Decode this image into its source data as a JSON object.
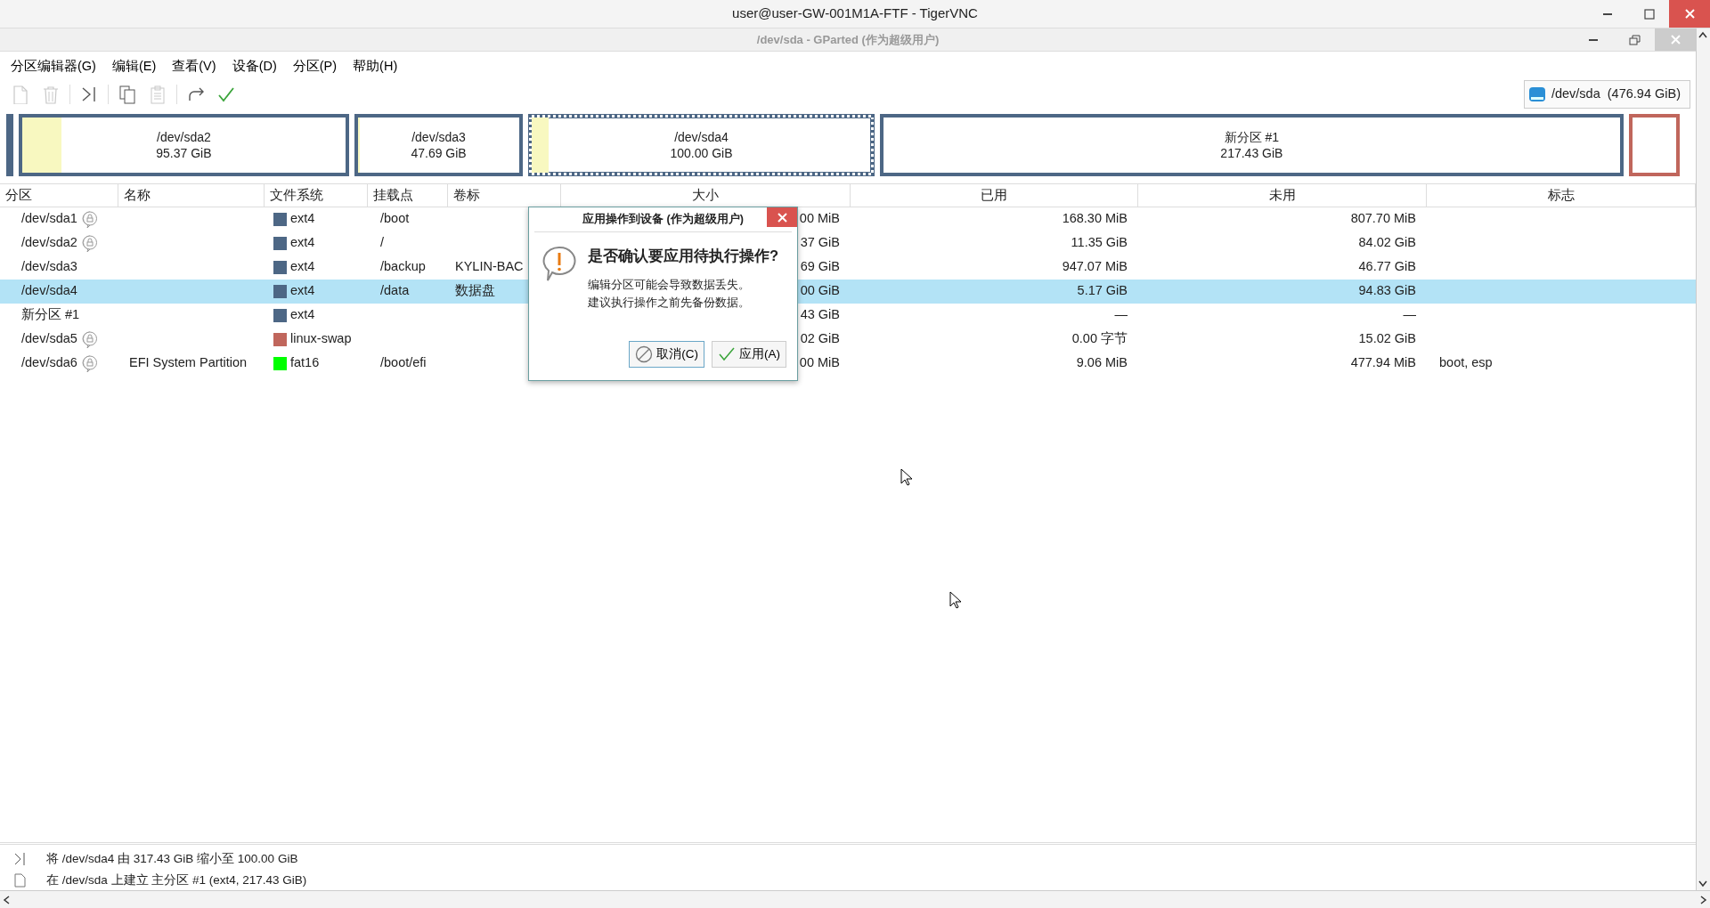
{
  "window": {
    "title": "user@user-GW-001M1A-FTF - TigerVNC"
  },
  "app_window": {
    "title": "/dev/sda - GParted (作为超级用户)"
  },
  "menu": [
    "分区编辑器(G)",
    "编辑(E)",
    "查看(V)",
    "设备(D)",
    "分区(P)",
    "帮助(H)"
  ],
  "toolbar": [
    {
      "kind": "new",
      "disabled": true
    },
    {
      "kind": "delete",
      "disabled": true
    },
    {
      "kind": "resize",
      "disabled": false
    },
    {
      "kind": "copy",
      "disabled": false
    },
    {
      "kind": "paste",
      "disabled": true
    },
    {
      "kind": "undo",
      "disabled": false
    },
    {
      "kind": "apply",
      "disabled": false
    }
  ],
  "device": {
    "path": "/dev/sda",
    "size": "(476.94 GiB)"
  },
  "partition_map": [
    {
      "kind": "sliver",
      "color": "#4d6785"
    },
    {
      "kind": "partition",
      "name": "/dev/sda2",
      "size": "95.37 GiB",
      "color": "#4d6785",
      "level": 0.12,
      "selected": false
    },
    {
      "kind": "partition",
      "name": "/dev/sda3",
      "size": "47.69 GiB",
      "color": "#4d6785",
      "level": 0.01,
      "selected": false
    },
    {
      "kind": "partition",
      "name": "/dev/sda4",
      "size": "100.00 GiB",
      "color": "#4d6785",
      "level": 0.05,
      "selected": true
    },
    {
      "kind": "partition",
      "name": "新分区 #1",
      "size": "217.43 GiB",
      "color": "#4d6785",
      "selected": false
    },
    {
      "kind": "tail",
      "color": "#c0665c",
      "selected": false
    }
  ],
  "table": {
    "columns": [
      "分区",
      "名称",
      "文件系统",
      "挂载点",
      "卷标",
      "大小",
      "已用",
      "未用",
      "标志"
    ],
    "rows": [
      {
        "partition": "/dev/sda1",
        "locked": true,
        "fs": "ext4",
        "color": "#4d6785",
        "mount": "/boot",
        "size": "00 MiB",
        "used": "168.30 MiB",
        "unused": "807.70 MiB",
        "selected": false
      },
      {
        "partition": "/dev/sda2",
        "locked": true,
        "fs": "ext4",
        "color": "#4d6785",
        "mount": "/",
        "size": "37 GiB",
        "used": "11.35 GiB",
        "unused": "84.02 GiB",
        "selected": false
      },
      {
        "partition": "/dev/sda3",
        "locked": false,
        "fs": "ext4",
        "color": "#4d6785",
        "mount": "/backup",
        "label": "KYLIN-BAC",
        "size": "69 GiB",
        "used": "947.07 MiB",
        "unused": "46.77 GiB",
        "selected": false
      },
      {
        "partition": "/dev/sda4",
        "locked": false,
        "fs": "ext4",
        "color": "#4d6785",
        "mount": "/data",
        "label": "数据盘",
        "size": "00 GiB",
        "used": "5.17 GiB",
        "unused": "94.83 GiB",
        "selected": true
      },
      {
        "partition": "新分区 #1",
        "locked": false,
        "fs": "ext4",
        "color": "#4d6785",
        "size": "43 GiB",
        "used": "—",
        "unused": "—",
        "selected": false
      },
      {
        "partition": "/dev/sda5",
        "locked": true,
        "fs": "linux-swap",
        "color": "#c0665c",
        "size": "02 GiB",
        "used": "0.00 字节",
        "unused": "15.02 GiB",
        "selected": false
      },
      {
        "partition": "/dev/sda6",
        "locked": true,
        "name": "EFI System Partition",
        "fs": "fat16",
        "color": "#00ff00",
        "mount": "/boot/efi",
        "size": "00 MiB",
        "used": "9.06 MiB",
        "unused": "477.94 MiB",
        "flags": "boot, esp",
        "selected": false
      }
    ]
  },
  "dialog": {
    "title": "应用操作到设备 (作为超级用户)",
    "heading": "是否确认要应用待执行操作?",
    "body": [
      "编辑分区可能会导致数据丢失。",
      "建议执行操作之前先备份数据。"
    ],
    "buttons": [
      {
        "kind": "cancel",
        "label": "取消(C)",
        "focused": true
      },
      {
        "kind": "apply",
        "label": "应用(A)",
        "focused": false
      }
    ]
  },
  "operations": [
    {
      "kind": "resize",
      "text": "将 /dev/sda4 由 317.43 GiB 缩小至 100.00 GiB"
    },
    {
      "kind": "create",
      "text": "在 /dev/sda 上建立 主分区 #1 (ext4, 217.43 GiB)"
    }
  ]
}
